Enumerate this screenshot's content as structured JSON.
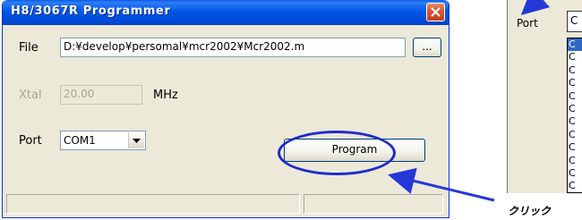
{
  "dialog": {
    "title": "H8/3067R Programmer",
    "file_label": "File",
    "file_value": "D:¥develop¥persomal¥mcr2002¥Mcr2002.m",
    "browse_label": "...",
    "xtal_label": "Xtal",
    "xtal_value": "20.00",
    "xtal_unit": "MHz",
    "port_label": "Port",
    "port_value": "COM1",
    "program_label": "Program"
  },
  "side_window": {
    "port_label": "Port",
    "port_value": "C",
    "list_items": [
      "C",
      "C",
      "C",
      "C",
      "C",
      "C",
      "C",
      "C",
      "C",
      "C",
      "C",
      "C"
    ]
  },
  "annotation": {
    "click_text": "クリック",
    "highlight_color": "#1f2bcc",
    "arrow_color": "#2438d8"
  }
}
